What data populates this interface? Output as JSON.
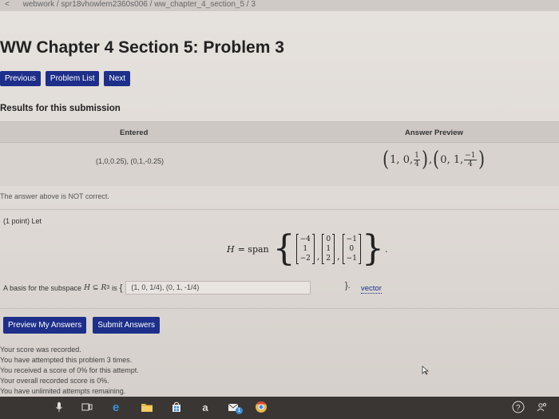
{
  "breadcrumb": {
    "back": "<",
    "path": "webwork / spr18vhowlem2360s006 / ww_chapter_4_section_5 / 3"
  },
  "page_title": "WW Chapter 4 Section 5: Problem 3",
  "nav": {
    "previous": "Previous",
    "problem_list": "Problem List",
    "next": "Next"
  },
  "results": {
    "heading": "Results for this submission",
    "col_entered": "Entered",
    "col_preview": "Answer Preview",
    "entered_value": "(1,0,0.25), (0,1,-0.25)",
    "preview": {
      "v1_prefix": "1, 0,",
      "v1_num": "1",
      "v1_den": "4",
      "sep": ",",
      "v2_prefix": "0, 1,",
      "v2_num": "−1",
      "v2_den": "4"
    },
    "status_msg": "The answer above is NOT correct."
  },
  "problem": {
    "points": "(1 point) Let",
    "H": "H",
    "eq": "= span",
    "matrices": [
      [
        "−4",
        "1",
        "−2"
      ],
      [
        "0",
        "1",
        "2"
      ],
      [
        "−1",
        "0",
        "−1"
      ]
    ],
    "period": ".",
    "basis_text_1": "A basis for the subspace",
    "basis_H": "H",
    "basis_subset": "⊆",
    "basis_R": "R",
    "basis_R_exp": "3",
    "basis_is": "is",
    "open_brace": "{",
    "answer_value": "(1, 0, 1/4), (0, 1, -1/4)",
    "close_brace": "}.",
    "vector_link": "vector"
  },
  "actions": {
    "preview": "Preview My Answers",
    "submit": "Submit Answers"
  },
  "score_messages": [
    "Your score was recorded.",
    "You have attempted this problem 3 times.",
    "You received a score of 0% for this attempt.",
    "Your overall recorded score is 0%.",
    "You have unlimited attempts remaining."
  ],
  "taskbar": {
    "icons": [
      "microphone-icon",
      "task-view-icon",
      "edge-icon",
      "file-explorer-icon",
      "store-icon",
      "amazon-icon",
      "mail-icon",
      "chrome-icon"
    ],
    "amazon_glyph": "a",
    "mail_badge": "1"
  },
  "colors": {
    "button_blue": "#1d2f8a",
    "page_bg": "#e2ded9",
    "taskbar": "#3a3633"
  }
}
